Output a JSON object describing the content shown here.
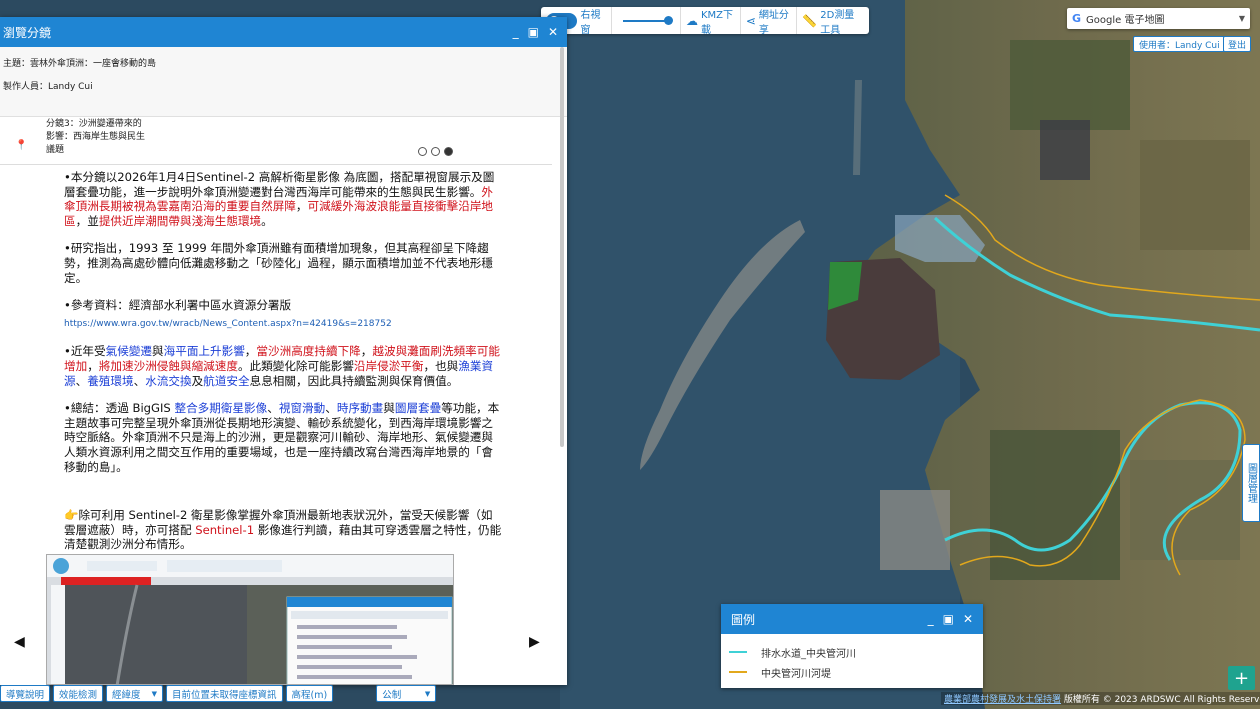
{
  "storyboard": {
    "window_title": "瀏覽分鏡",
    "topic": "主題：雲林外傘頂洲：一座會移動的島",
    "author": "製作人員：Landy Cui",
    "chapter_title": "分鏡3：沙洲變遷帶來的影響：西海岸生態與民生議題",
    "para1_a": "•本分鏡以2026年1月4日Sentinel-2 高解析衛星影像 為底圖，搭配單視窗展示及圖層套疊功能，進一步說明外傘頂洲變遷對台灣西海岸可能帶來的生態與民生影響。",
    "para1_red1": "外傘頂洲長期被視為雲嘉南沿海的重要自然屏障",
    "para1_b": "，",
    "para1_red2": "可減緩外海波浪能量直接衝擊沿岸地區",
    "para1_c": "，並",
    "para1_red3": "提供近岸潮間帶與淺海生態環境",
    "para1_d": "。",
    "para2": "•研究指出，1993 至 1999 年間外傘頂洲雖有面積增加現象，但其高程卻呈下降趨勢，推測為高處砂體向低灘處移動之「砂陸化」過程，顯示面積增加並不代表地形穩定。",
    "ref_label": "•參考資料：經濟部水利署中區水資源分署版",
    "ref_url": "https://www.wra.gov.tw/wracb/News_Content.aspx?n=42419&s=218752",
    "p3_a": "•近年受",
    "p3_b1": "氣候變遷",
    "p3_c": "與",
    "p3_b2": "海平面上升影響",
    "p3_d": "，",
    "p3_r1": "當沙洲高度持續下降",
    "p3_e": "，",
    "p3_r2": "越波與灘面刷洗頻率可能增加",
    "p3_f": "，",
    "p3_r3": "將加速沙洲侵蝕與縮減速度",
    "p3_g": "。此類變化除可能影響",
    "p3_r4": "沿岸侵淤平衡",
    "p3_h": "，也與",
    "p3_b3": "漁業資源",
    "p3_i": "、",
    "p3_b4": "養殖環境",
    "p3_j": "、",
    "p3_b5": "水流交換",
    "p3_k": "及",
    "p3_b6": "航道安全",
    "p3_l": "息息相關，因此具持續監測與保育價值。",
    "p4_a": "•總結：透過 BigGIS ",
    "p4_b1": "整合多期衛星影像",
    "p4_c": "、",
    "p4_b2": "視窗滑動",
    "p4_d": "、",
    "p4_b3": "時序動畫",
    "p4_e": "與",
    "p4_b4": "圖層套疊",
    "p4_f": "等功能，本主題故事可完整呈現外傘頂洲從長期地形演變、輸砂系統變化，到西海岸環境影響之時空脈絡。外傘頂洲不只是海上的沙洲，更是觀察河川輸砂、海岸地形、氣候變遷與人類水資源利用之間交互作用的重要場域，也是一座持續改寫台灣西海岸地景的「會移動的島」。",
    "note_hand": "👉",
    "note_a": "除可利用 Sentinel-2 衛星影像掌握外傘頂洲最新地表狀況外，當受天候影響（如雲層遮蔽）時，亦可搭配 ",
    "note_red": "Sentinel-1",
    "note_b": " 影像進行判讀，藉由其可穿透雲層之特性，仍能清楚觀測沙洲分布情形。"
  },
  "map_toolbar": {
    "right_window": "右視窗",
    "kmz": "KMZ下載",
    "share": "網址分享",
    "measure": "2D測量工具"
  },
  "basemap": {
    "label": "Google 電子地圖"
  },
  "user": {
    "label": "使用者：Landy Cui",
    "logout": "登出"
  },
  "side_tab": "圖層管理",
  "legend": {
    "title": "圖例",
    "items": [
      {
        "label": "排水水道_中央管河川",
        "color": "#3fd1d6"
      },
      {
        "label": "中央管河川河堤",
        "color": "#e2a81c"
      }
    ]
  },
  "bottom_bar": {
    "guide": "導覽說明",
    "perf": "效能檢測",
    "coord": "經緯度",
    "pos": "目前位置未取得座標資訊",
    "elev": "高程(m)",
    "unit": "公制"
  },
  "copyright": {
    "link": "農業部農村發展及水土保持署",
    "rest": " 版權所有 © 2023 ARDSWC All Rights Reserved"
  }
}
